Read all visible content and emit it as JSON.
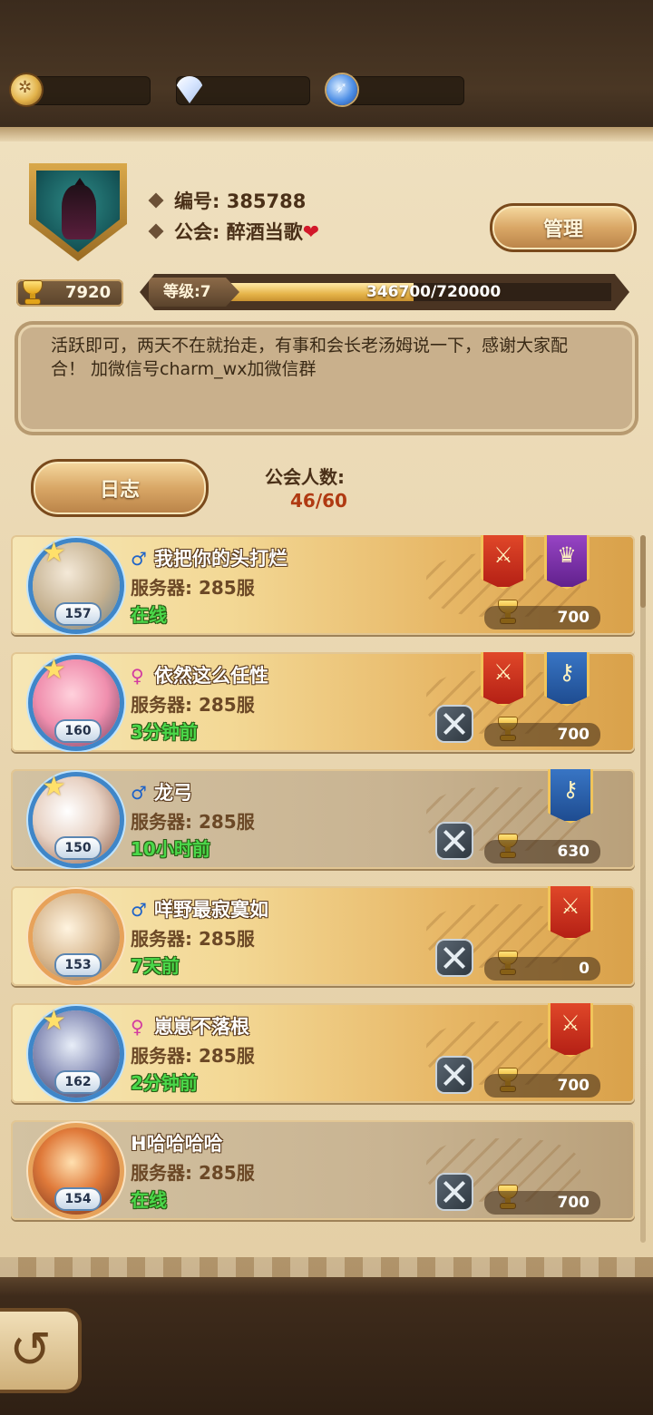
{
  "resources": [
    {
      "icon": "gold-coin-icon",
      "value": ""
    },
    {
      "icon": "diamond-icon",
      "value": ""
    },
    {
      "icon": "blue-orb-icon",
      "value": ""
    }
  ],
  "guild": {
    "id_label": "编号: 385788",
    "name_label": "公会: 醉酒当歌",
    "manage_button": "管理",
    "trophy_total": "7920",
    "level_label": "等级:7",
    "exp_text": "346700/720000",
    "exp_fraction": 0.4815,
    "notice": "活跃即可，两天不在就抬走，有事和会长老汤姆说一下，感谢大家配合！ 加微信号charm_wx加微信群",
    "log_button": "日志",
    "members_label": "公会人数:",
    "members_count": "46/60"
  },
  "members": [
    {
      "gender": "male",
      "name": "我把你的头打烂",
      "server": "服务器: 285服",
      "status": "在线",
      "level": "157",
      "score": "700",
      "banners": [
        "red",
        "purple"
      ],
      "has_swords": false,
      "style": "gold"
    },
    {
      "gender": "female",
      "name": "依然这么任性",
      "server": "服务器: 285服",
      "status": "3分钟前",
      "level": "160",
      "score": "700",
      "banners": [
        "red",
        "blue"
      ],
      "has_swords": true,
      "style": "gold"
    },
    {
      "gender": "male",
      "name": "龙弓",
      "server": "服务器: 285服",
      "status": "10小时前",
      "level": "150",
      "score": "630",
      "banners": [
        "blue"
      ],
      "has_swords": true,
      "style": "plain"
    },
    {
      "gender": "male",
      "name": "咩野最寂寞如",
      "server": "服务器: 285服",
      "status": "7天前",
      "level": "153",
      "score": "0",
      "banners": [
        "red"
      ],
      "has_swords": true,
      "style": "gold"
    },
    {
      "gender": "female",
      "name": "崽崽不落根",
      "server": "服务器: 285服",
      "status": "2分钟前",
      "level": "162",
      "score": "700",
      "banners": [
        "red"
      ],
      "has_swords": true,
      "style": "gold"
    },
    {
      "gender": "",
      "name": "H哈哈哈哈",
      "server": "服务器: 285服",
      "status": "在线",
      "level": "154",
      "score": "700",
      "banners": [],
      "has_swords": true,
      "style": "plain"
    }
  ],
  "colors": {
    "accent": "#b03a12",
    "online": "#4bd84a",
    "parchment": "#efe0bf"
  }
}
